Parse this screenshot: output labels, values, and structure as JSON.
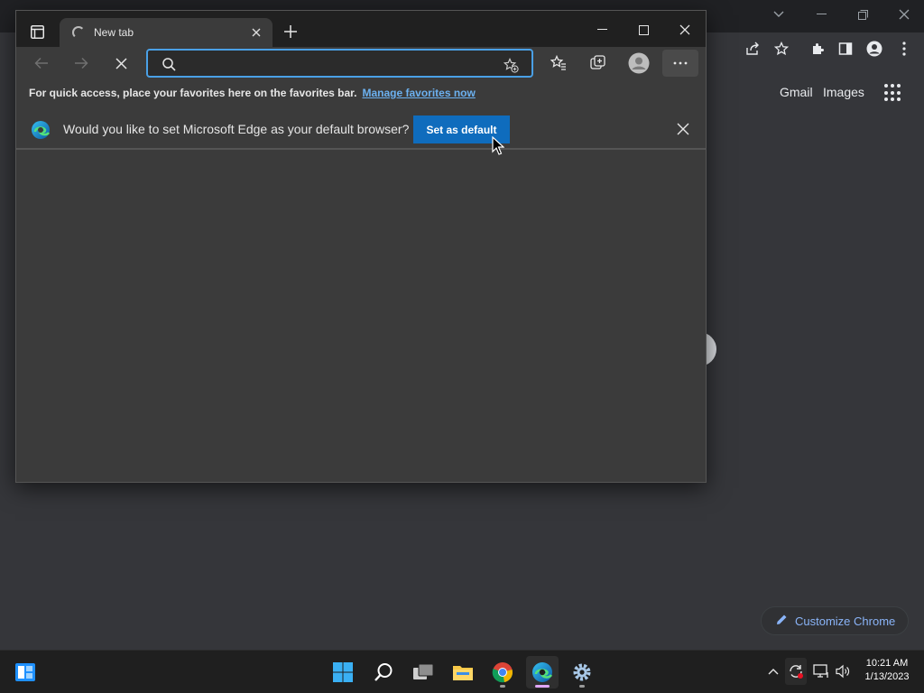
{
  "chrome_window": {
    "links": {
      "gmail": "Gmail",
      "images": "Images"
    },
    "customize_label": "Customize Chrome"
  },
  "edge_window": {
    "tab": {
      "title": "New tab"
    },
    "address_bar": {
      "value": "",
      "placeholder": ""
    },
    "favorites_bar": {
      "text": "For quick access, place your favorites here on the favorites bar.",
      "link": "Manage favorites now"
    },
    "infobar": {
      "message": "Would you like to set Microsoft Edge as your default browser?",
      "button_label": "Set as default"
    }
  },
  "taskbar": {
    "apps": [
      "widgets-icon",
      "start-icon",
      "search-icon",
      "task-view-icon",
      "file-explorer-icon",
      "chrome-icon",
      "edge-icon",
      "settings-icon"
    ],
    "clock": {
      "time": "10:21 AM",
      "date": "1/13/2023"
    }
  },
  "colors": {
    "edge_accent": "#0f6cbd",
    "link_blue": "#6cb1f0",
    "chrome_bg": "#35363a"
  }
}
